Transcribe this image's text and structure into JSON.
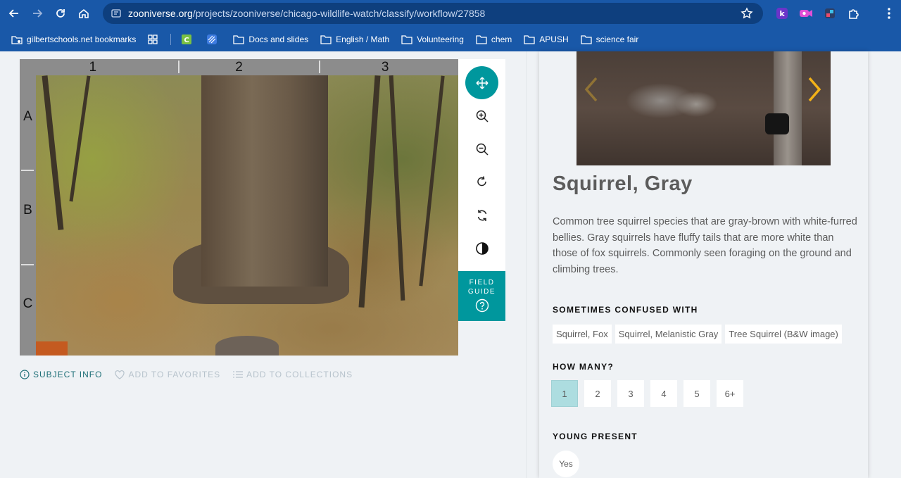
{
  "browser": {
    "url_domain": "zooniverse.org",
    "url_path": "/projects/zooniverse/chicago-wildlife-watch/classify/workflow/27858",
    "bookmarks": [
      {
        "label": "gilbertschools.net bookmarks",
        "icon": "managed-bookmarks-icon"
      },
      {
        "label": "Docs and slides",
        "icon": "folder-icon"
      },
      {
        "label": "English / Math",
        "icon": "folder-icon"
      },
      {
        "label": "Volunteering",
        "icon": "folder-icon"
      },
      {
        "label": "chem",
        "icon": "folder-icon"
      },
      {
        "label": "APUSH",
        "icon": "folder-icon"
      },
      {
        "label": "science fair",
        "icon": "folder-icon"
      }
    ],
    "extensions": [
      "k-extension-icon",
      "video-extension-icon",
      "colorful-extension-icon",
      "puzzle-icon",
      "more-menu-icon"
    ]
  },
  "subject": {
    "grid_columns": [
      "1",
      "2",
      "3"
    ],
    "grid_rows": [
      "A",
      "B",
      "C"
    ]
  },
  "toolbar": {
    "tools": [
      "move-icon",
      "zoom-in-icon",
      "zoom-out-icon",
      "rotate-icon",
      "reset-icon",
      "invert-icon"
    ],
    "field_guide_line1": "FIELD",
    "field_guide_line2": "GUIDE"
  },
  "meta": {
    "subject_info": "SUBJECT INFO",
    "add_favorites": "ADD TO FAVORITES",
    "add_collections": "ADD TO COLLECTIONS"
  },
  "species": {
    "name": "Squirrel, Gray",
    "description": "Common tree squirrel species that are gray-brown with white-furred bellies. Gray squirrels have fluffy tails that are more white than those of fox squirrels. Commonly seen foraging on the ground and climbing trees.",
    "confused_title": "SOMETIMES CONFUSED WITH",
    "confused_with": [
      "Squirrel, Fox",
      "Squirrel, Melanistic Gray",
      "Tree Squirrel (B&W image)"
    ],
    "how_many_title": "HOW MANY?",
    "how_many_options": [
      "1",
      "2",
      "3",
      "4",
      "5",
      "6+"
    ],
    "how_many_selected": "1",
    "young_title": "YOUNG PRESENT",
    "young_option": "Yes"
  },
  "colors": {
    "teal": "#00979d",
    "chrome_blue": "#1958a8",
    "muted_text": "#5c5c5c"
  }
}
